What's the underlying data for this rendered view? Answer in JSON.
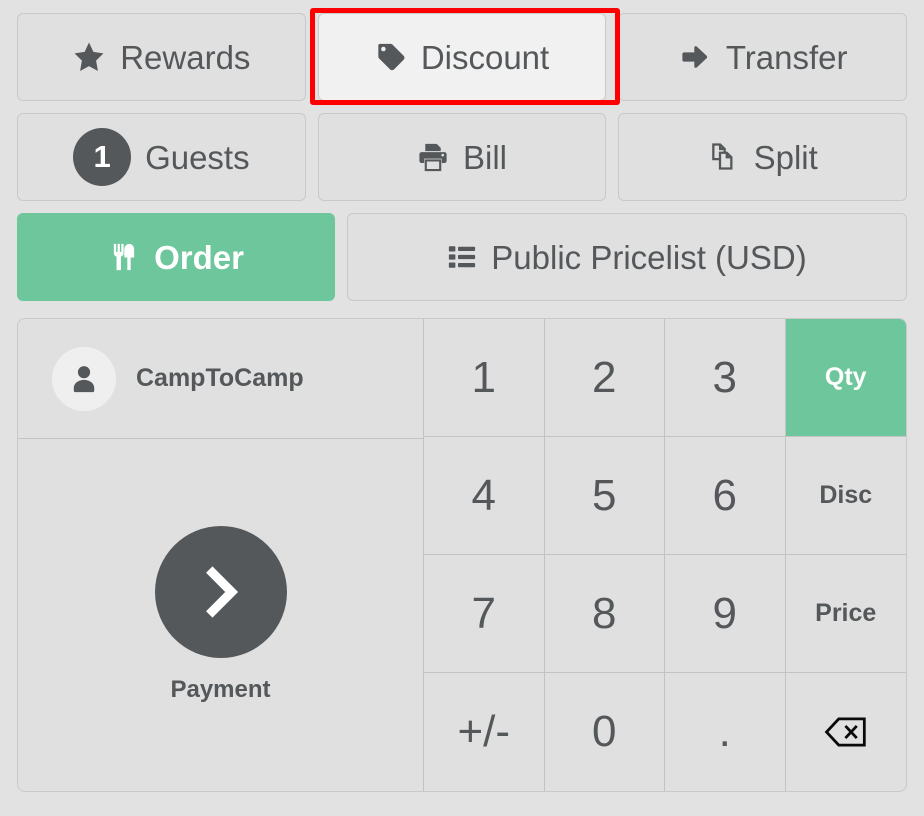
{
  "theme": {
    "page_background": "#e2e2e2",
    "button_background": "#e0e0e0",
    "button_background_light": "#f1f1f1",
    "accent_green": "#6ec69c",
    "text_dark": "#55585a",
    "highlight_red": "#ff0000",
    "border": "#c9c9c9"
  },
  "action_rows": {
    "row1": [
      {
        "label": "Rewards",
        "icon": "star-icon",
        "state": "default"
      },
      {
        "label": "Discount",
        "icon": "tag-icon",
        "state": "highlighted"
      },
      {
        "label": "Transfer",
        "icon": "arrow-right-icon",
        "state": "default"
      }
    ],
    "row2": [
      {
        "label": "Guests",
        "icon": "guest-count-badge",
        "badge": "1",
        "state": "default"
      },
      {
        "label": "Bill",
        "icon": "printer-icon",
        "state": "default"
      },
      {
        "label": "Split",
        "icon": "copy-pages-icon",
        "state": "default"
      }
    ],
    "row3": [
      {
        "label": "Order",
        "icon": "cutlery-icon",
        "state": "active"
      },
      {
        "label": "Public Pricelist (USD)",
        "icon": "list-icon",
        "state": "default"
      }
    ]
  },
  "customer": {
    "name": "CampToCamp",
    "avatar_icon": "person-icon"
  },
  "payment": {
    "label": "Payment",
    "icon": "chevron-right-icon"
  },
  "numpad": {
    "keys": [
      {
        "label": "1",
        "type": "digit",
        "state": "default"
      },
      {
        "label": "2",
        "type": "digit",
        "state": "default"
      },
      {
        "label": "3",
        "type": "digit",
        "state": "default"
      },
      {
        "label": "Qty",
        "type": "mode",
        "state": "active"
      },
      {
        "label": "4",
        "type": "digit",
        "state": "default"
      },
      {
        "label": "5",
        "type": "digit",
        "state": "default"
      },
      {
        "label": "6",
        "type": "digit",
        "state": "default"
      },
      {
        "label": "Disc",
        "type": "mode",
        "state": "default"
      },
      {
        "label": "7",
        "type": "digit",
        "state": "default"
      },
      {
        "label": "8",
        "type": "digit",
        "state": "default"
      },
      {
        "label": "9",
        "type": "digit",
        "state": "default"
      },
      {
        "label": "Price",
        "type": "mode",
        "state": "default"
      },
      {
        "label": "+/-",
        "type": "sign",
        "state": "default"
      },
      {
        "label": "0",
        "type": "digit",
        "state": "default"
      },
      {
        "label": ".",
        "type": "digit",
        "state": "default"
      },
      {
        "label": "",
        "type": "backspace",
        "icon": "backspace-icon",
        "state": "default"
      }
    ]
  }
}
